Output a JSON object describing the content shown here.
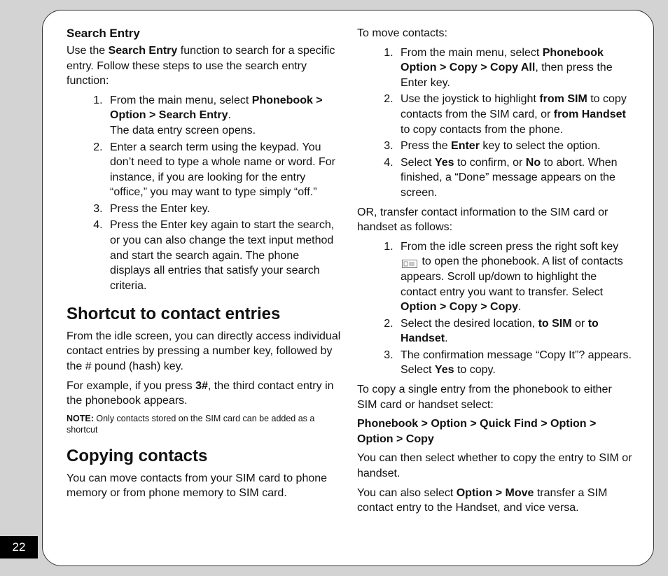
{
  "page_number": "22",
  "left": {
    "search_entry": {
      "heading": "Search Entry",
      "intro_pre": "Use the ",
      "intro_bold": "Search Entry",
      "intro_post": " function to search for a specific entry. Follow these steps to use the search entry function:",
      "steps": {
        "s1_pre": "From the main menu, select ",
        "s1_bold": "Phonebook > Option > Search Entry",
        "s1_post": ".",
        "s1_line2": "The data entry screen opens.",
        "s2": "Enter a search term using the keypad. You don’t need to type a whole name or word. For instance, if you are looking for the entry “office,” you may want to type simply “off.”",
        "s3": "Press the Enter key.",
        "s4": "Press the Enter key again to start the search, or you can also change the text input method and start the search again. The phone displays all entries that satisfy your search criteria."
      }
    },
    "shortcut": {
      "heading": "Shortcut to contact entries",
      "p1": "From the idle screen, you can directly access individual contact entries by pressing a number key, followed by the # pound (hash) key.",
      "p2_pre": "For example, if you press ",
      "p2_bold": "3#",
      "p2_post": ", the third contact entry in the phonebook appears.",
      "note_label": "NOTE:",
      "note_text": " Only contacts stored on the SIM card can be added as a shortcut"
    },
    "copying": {
      "heading": "Copying contacts",
      "p1": "You can move contacts from your SIM card to phone memory or from phone memory to SIM card."
    }
  },
  "right": {
    "move_intro": "To move contacts:",
    "move_steps": {
      "s1_pre": "From the main menu, select ",
      "s1_bold": "Phonebook Option > Copy > Copy All",
      "s1_post": ", then press the Enter key.",
      "s2_pre": "Use the joystick to highlight ",
      "s2_b1": "from SIM",
      "s2_mid": " to copy contacts from the SIM card, or ",
      "s2_b2": "from Handset",
      "s2_post": " to copy contacts from the phone.",
      "s3_pre": "Press the ",
      "s3_bold": "Enter",
      "s3_post": " key to select the option.",
      "s4_pre": "Select ",
      "s4_b1": "Yes",
      "s4_mid1": " to confirm, or ",
      "s4_b2": "No",
      "s4_mid2": " to abort. When finished, a “Done” message appears on the screen."
    },
    "or_p": "OR, transfer contact information to the SIM card or handset as follows:",
    "transfer_steps": {
      "s1_pre": "From the idle screen press the right soft key ",
      "s1_post": " to open the phonebook. A list of contacts appears. Scroll up/down to highlight the contact entry you want to transfer. Select ",
      "s1_bold": "Option > Copy > Copy",
      "s1_end": ".",
      "s2_pre": "Select the desired location, ",
      "s2_b1": "to SIM",
      "s2_mid": " or ",
      "s2_b2": "to Handset",
      "s2_post": ".",
      "s3_pre": "The confirmation message “Copy It”? appears. Select ",
      "s3_bold": "Yes",
      "s3_post": " to copy."
    },
    "single_intro": "To copy a single entry from the phonebook to either SIM card or handset select:",
    "single_path": "Phonebook > Option > Quick Find > Option > Option > Copy",
    "single_dest": "You can then select whether to copy the entry to SIM or handset.",
    "move_option_pre": "You can also select ",
    "move_option_bold": "Option > Move",
    "move_option_post": " transfer a SIM contact entry to the Handset, and vice versa."
  }
}
